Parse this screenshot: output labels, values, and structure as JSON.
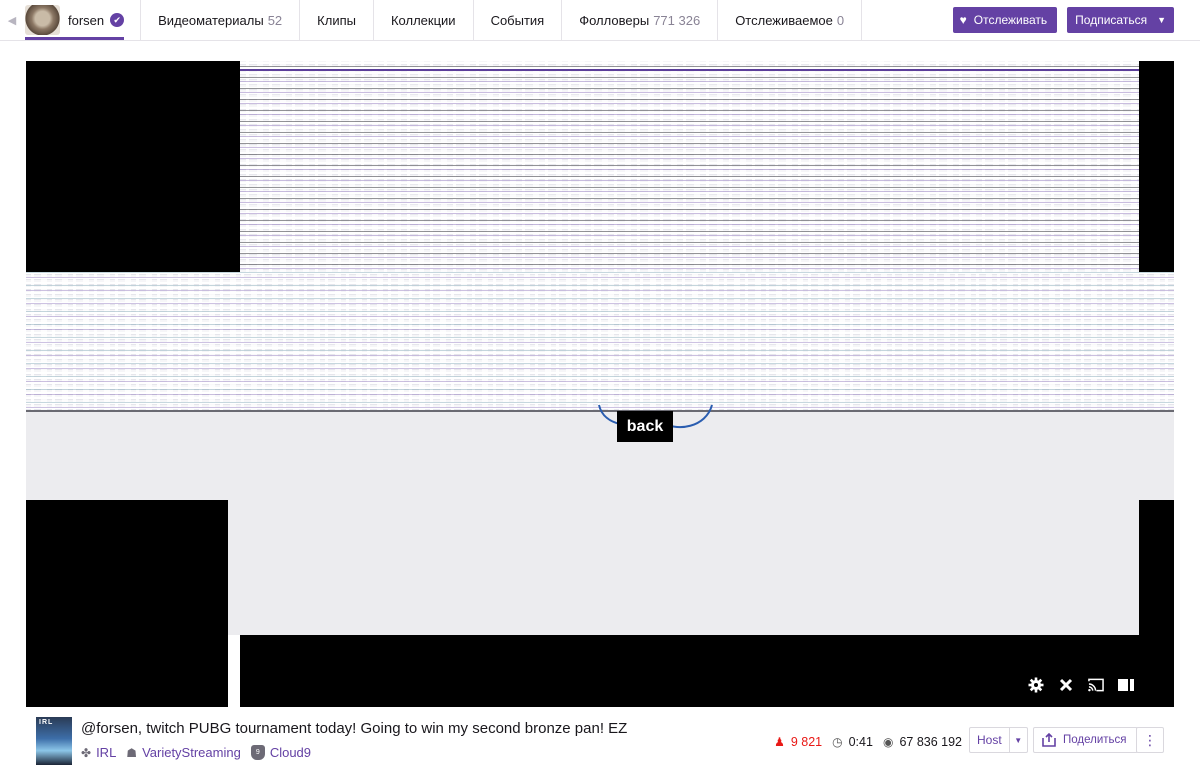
{
  "nav": {
    "back_arrow": "◀",
    "channel_name": "forsen",
    "verified_icon": "verified-check-icon",
    "tabs": [
      {
        "label": "Видеоматериалы",
        "count": "52"
      },
      {
        "label": "Клипы",
        "count": ""
      },
      {
        "label": "Коллекции",
        "count": ""
      },
      {
        "label": "События",
        "count": ""
      },
      {
        "label": "Фолловеры",
        "count": "771 326"
      },
      {
        "label": "Отслеживаемое",
        "count": "0"
      }
    ],
    "follow_label": "Отслеживать",
    "subscribe_label": "Подписаться"
  },
  "player": {
    "overlay_text": "back",
    "controls": [
      "settings-icon",
      "close-icon",
      "cast-icon",
      "theater-mode-icon"
    ]
  },
  "info": {
    "thumbnail_label": "IRL",
    "title": "@forsen, twitch PUBG tournament today! Going to win my second bronze pan! EZ",
    "game": "IRL",
    "community": "VarietyStreaming",
    "team": "Cloud9",
    "viewers": "9 821",
    "uptime": "0:41",
    "total_views": "67 836 192",
    "host_label": "Host",
    "share_label": "Поделиться",
    "more_label": "⋮"
  },
  "colors": {
    "accent": "#6441a4",
    "live_red": "#e91916",
    "border": "#dad8de"
  }
}
